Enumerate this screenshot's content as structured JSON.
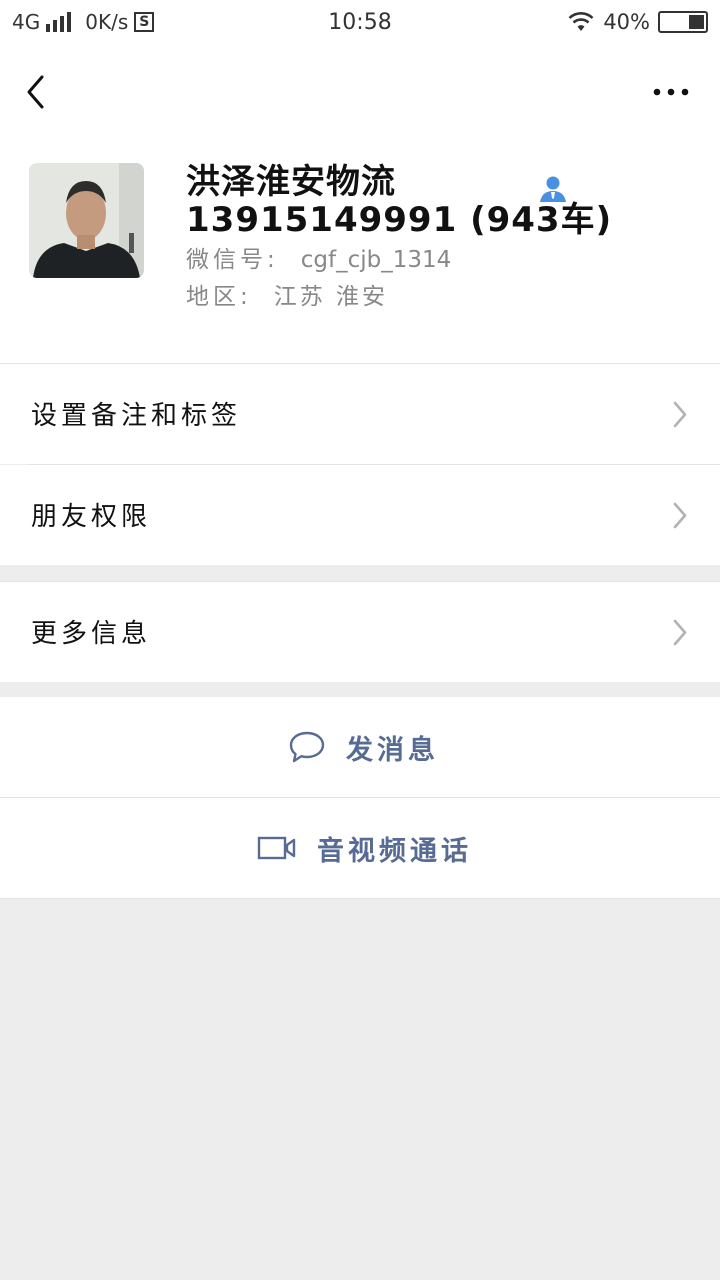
{
  "status_bar": {
    "network": "4G",
    "speed": "0K/s",
    "time": "10:58",
    "battery": "40%"
  },
  "nav": {
    "back_icon": "chevron-left-icon",
    "more_icon": "more-dots-icon"
  },
  "profile": {
    "name": "洪泽淮安物流",
    "remark": "13915149991 (943车)",
    "wechat_id_label": "微信号:",
    "wechat_id": "cgf_cjb_1314",
    "region_label": "地区:",
    "region": "江苏 淮安",
    "contact_icon_color": "#4a90e2"
  },
  "menu": {
    "set_remark_tags": "设置备注和标签",
    "friend_permissions": "朋友权限",
    "more_info": "更多信息"
  },
  "actions": {
    "send_message": "发消息",
    "video_call": "音视频通话",
    "accent_color": "#576b95"
  }
}
